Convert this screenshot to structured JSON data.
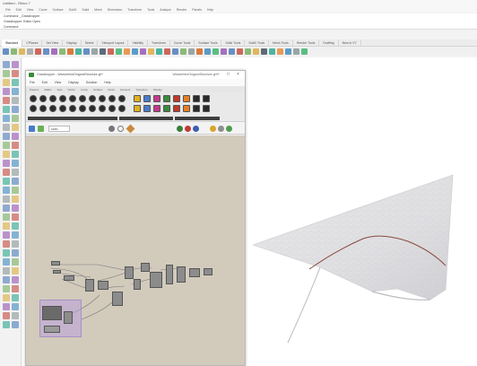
{
  "rhino": {
    "title": "Untitled - Rhino 7",
    "menu": [
      "File",
      "Edit",
      "View",
      "Curve",
      "Surface",
      "SubD",
      "Solid",
      "Mesh",
      "Dimension",
      "Transform",
      "Tools",
      "Analyze",
      "Render",
      "Panels",
      "Help"
    ],
    "command_history": [
      "Command: _Grasshopper",
      "Grasshopper: Editor Open"
    ],
    "command_prompt": "Command:",
    "toolbar_tabs": [
      "Standard",
      "CPlanes",
      "Set View",
      "Display",
      "Select",
      "Viewport Layout",
      "Visibility",
      "Transform",
      "Curve Tools",
      "Surface Tools",
      "Solid Tools",
      "SubD Tools",
      "Mesh Tools",
      "Render Tools",
      "Drafting",
      "New in V7"
    ],
    "active_tab_index": 0
  },
  "grasshopper": {
    "title": "Grasshopper - WeaverbirdOrigamiStructure.gh*",
    "file_label": "WeaverbirdOrigamiStructure.gh*",
    "menu": [
      "File",
      "Edit",
      "View",
      "Display",
      "Solution",
      "Help"
    ],
    "tabs": [
      "Params",
      "Maths",
      "Sets",
      "Vector",
      "Curve",
      "Surface",
      "Mesh",
      "Intersect",
      "Transform",
      "Display"
    ],
    "zoom_value": "100%"
  },
  "colors": {
    "gh_canvas": "#d2cbbc",
    "group_fill": "#b9a0dc",
    "surface_fill": "#e4e4e6",
    "curve_stroke": "#8a4a3a"
  }
}
